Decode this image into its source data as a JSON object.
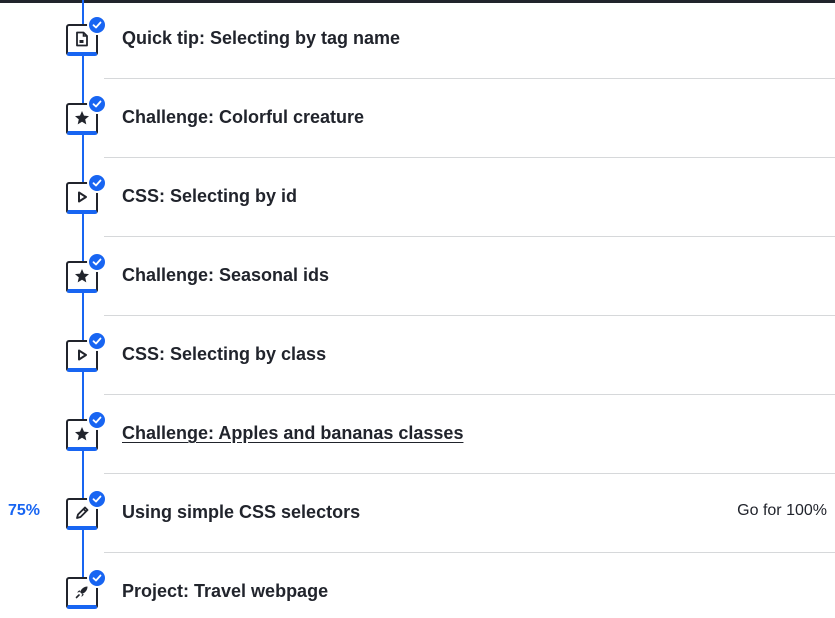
{
  "items": [
    {
      "title": "Quick tip: Selecting by tag name",
      "icon": "document-icon",
      "completed": true
    },
    {
      "title": "Challenge: Colorful creature",
      "icon": "star-icon",
      "completed": true
    },
    {
      "title": "CSS: Selecting by id",
      "icon": "play-icon",
      "completed": true
    },
    {
      "title": "Challenge: Seasonal ids",
      "icon": "star-icon",
      "completed": true
    },
    {
      "title": "CSS: Selecting by class",
      "icon": "play-icon",
      "completed": true
    },
    {
      "title": "Challenge: Apples and bananas classes",
      "icon": "star-icon",
      "completed": true
    },
    {
      "title": "Using simple CSS selectors",
      "icon": "pencil-icon",
      "completed": true,
      "score": "75%",
      "action": "Go for 100%"
    },
    {
      "title": "Project: Travel webpage",
      "icon": "rocket-icon",
      "completed": true
    }
  ],
  "colors": {
    "accent": "#1865f2",
    "text": "#21242c",
    "divider": "#d6d8da"
  }
}
